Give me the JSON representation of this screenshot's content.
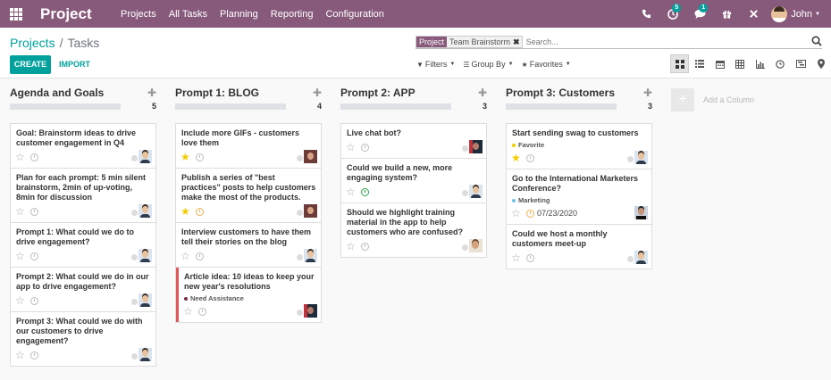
{
  "app": {
    "title": "Project",
    "menu": [
      "Projects",
      "All Tasks",
      "Planning",
      "Reporting",
      "Configuration"
    ],
    "activity_badge": "5",
    "messages_badge": "1",
    "user_name": "John"
  },
  "breadcrumb": {
    "parent": "Projects",
    "current": "Tasks"
  },
  "actions": {
    "create": "CREATE",
    "import": "IMPORT"
  },
  "search": {
    "facet_name": "Project",
    "facet_value": "Team Brainstorm",
    "placeholder": "Search..."
  },
  "filters": {
    "filters": "Filters",
    "group_by": "Group By",
    "favorites": "Favorites"
  },
  "kanban": {
    "add_column": "Add a Column",
    "columns": [
      {
        "title": "Agenda and Goals",
        "count": "5",
        "cards": [
          {
            "title": "Goal: Brainstorm ideas to drive customer engagement in Q4"
          },
          {
            "title": "Plan for each prompt: 5 min silent brainstorm, 2min of up-voting, 8min for discussion"
          },
          {
            "title": "Prompt 1: What could we do to drive engagement?"
          },
          {
            "title": "Prompt 2: What could we do in our app to drive engagement?"
          },
          {
            "title": "Prompt 3: What could we do with our customers to drive engagement?"
          }
        ]
      },
      {
        "title": "Prompt 1: BLOG",
        "count": "4",
        "cards": [
          {
            "title": "Include more GIFs - customers love them"
          },
          {
            "title": "Publish a series of \"best practices\" posts to help customers make the most of the products."
          },
          {
            "title": "Interview customers to have them tell their stories on the blog"
          },
          {
            "title": "Article idea: 10 ideas to keep your new year's resolutions",
            "tag": "Need Assistance"
          }
        ]
      },
      {
        "title": "Prompt 2: APP",
        "count": "3",
        "cards": [
          {
            "title": "Live chat bot?"
          },
          {
            "title": "Could we build a new, more engaging system?"
          },
          {
            "title": "Should we highlight training material in the app to help customers who are confused?"
          }
        ]
      },
      {
        "title": "Prompt 3: Customers",
        "count": "3",
        "cards": [
          {
            "title": "Start sending swag to customers",
            "tag": "Favorite"
          },
          {
            "title": "Go to the International Marketers Conference?",
            "tag": "Marketing",
            "date": "07/23/2020"
          },
          {
            "title": "Could we host a monthly customers meet-up"
          }
        ]
      }
    ]
  },
  "colors": {
    "brand": "#875a7b",
    "accent": "#00a09d",
    "star": "#f3cc00",
    "danger": "#e05959"
  }
}
